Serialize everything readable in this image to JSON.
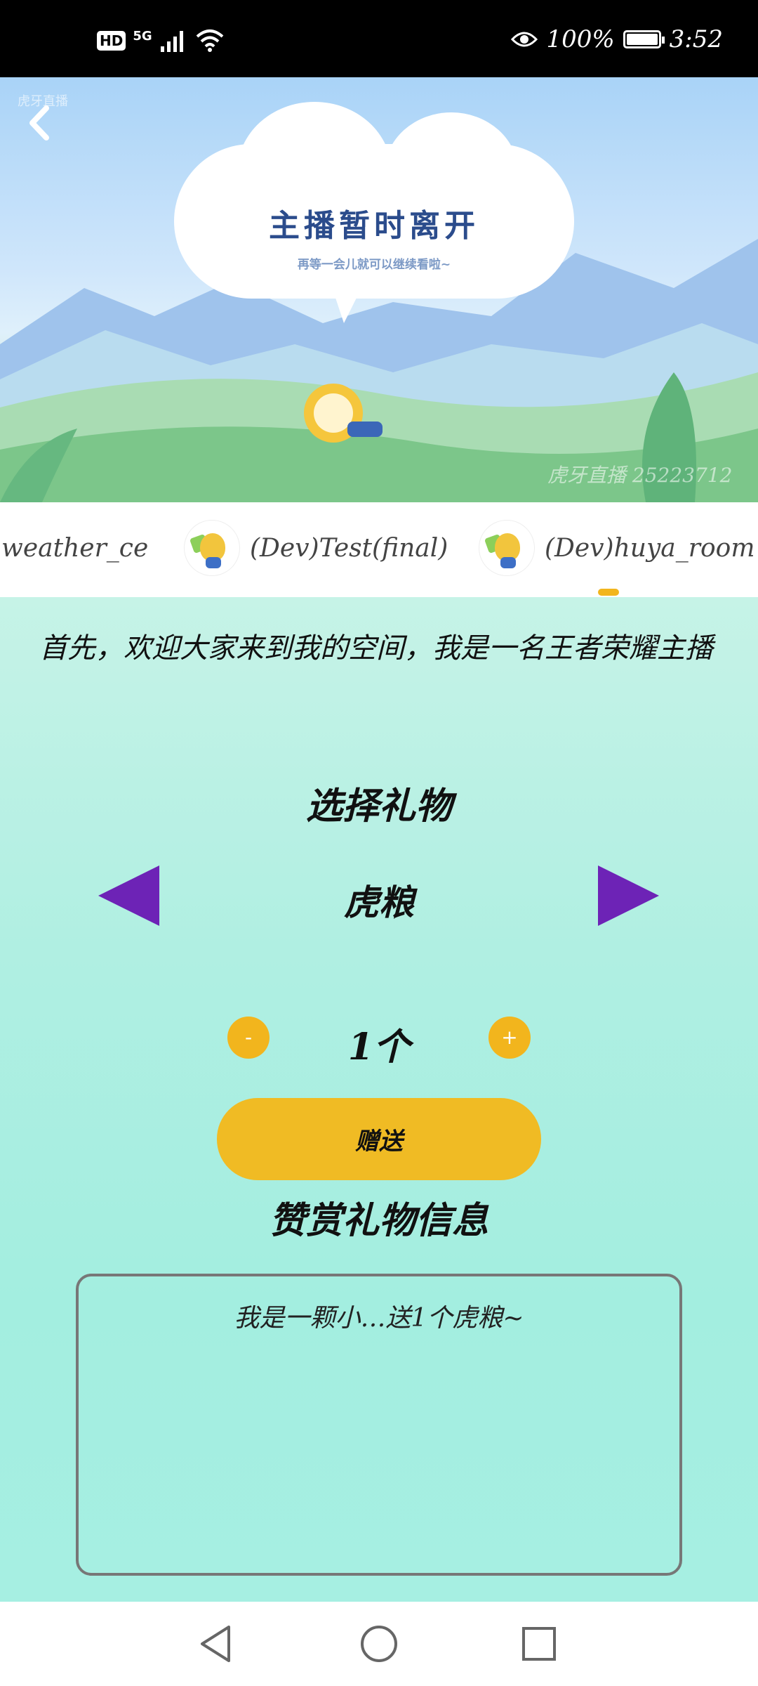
{
  "status_bar": {
    "hd": "HD",
    "network": "5G",
    "battery_percent": "100%",
    "battery_level": 1.0,
    "time": "3:52",
    "icons": [
      "hd-icon",
      "signal-icon",
      "wifi-icon",
      "eye-icon",
      "battery-icon"
    ]
  },
  "hero": {
    "logo": "虎牙直播",
    "title": "主播暂时离开",
    "subtitle": "再等一会儿就可以继续看啦~",
    "watermark": "虎牙直播 25223712"
  },
  "channels": [
    {
      "name": ")weather_ce"
    },
    {
      "name": "(Dev)Test(final)"
    },
    {
      "name": "(Dev)huya_room"
    }
  ],
  "main": {
    "intro": "首先，欢迎大家来到我的空间，我是一名王者荣耀主播",
    "select_title": "选择礼物",
    "gift_name": "虎粮",
    "minus_label": "-",
    "plus_label": "+",
    "quantity": "1个",
    "send_label": "赠送",
    "info_title": "赞赏礼物信息",
    "info_line": "我是一颗小…送1个虎粮~"
  },
  "colors": {
    "accent_purple": "#6d23b6",
    "accent_yellow": "#f2b51d",
    "send_button": "#f0bb24",
    "background_mint": "#a6efe2"
  }
}
